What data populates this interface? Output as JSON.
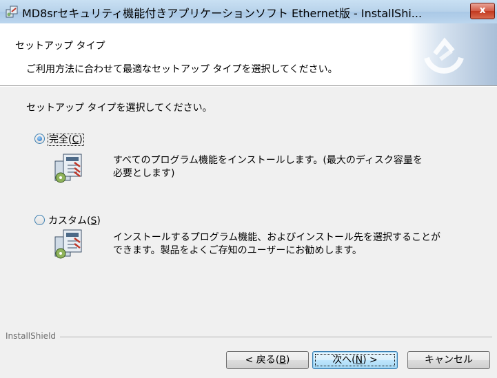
{
  "window": {
    "title": "MD8srセキュリティ機能付きアプリケーションソフト Ethernet版 - InstallShi...",
    "close_label": "x"
  },
  "header": {
    "title": "セットアップ タイプ",
    "description": "ご利用方法に合わせて最適なセットアップ タイプを選択してください。"
  },
  "prompt": "セットアップ タイプを選択してください。",
  "options": [
    {
      "label": "完全",
      "mnemonic": "C",
      "checked": true,
      "description_lines": [
        "すべてのプログラム機能をインストールします。(最大のディスク容量を",
        "必要とします)"
      ]
    },
    {
      "label": "カスタム",
      "mnemonic": "S",
      "checked": false,
      "description_lines": [
        "インストールするプログラム機能、およびインストール先を選択することが",
        "できます。製品をよくご存知のユーザーにお勧めします。"
      ]
    }
  ],
  "footer": {
    "brand": "InstallShield",
    "back_prefix": "< 戻る(",
    "back_key": "B",
    "back_suffix": ")",
    "next_prefix": "次へ(",
    "next_key": "N",
    "next_suffix": ") >",
    "cancel_label": "キャンセル"
  },
  "colors": {
    "titlebar": "#b7d2ea",
    "close_button": "#c2381f",
    "accent": "#3c7fb1"
  }
}
